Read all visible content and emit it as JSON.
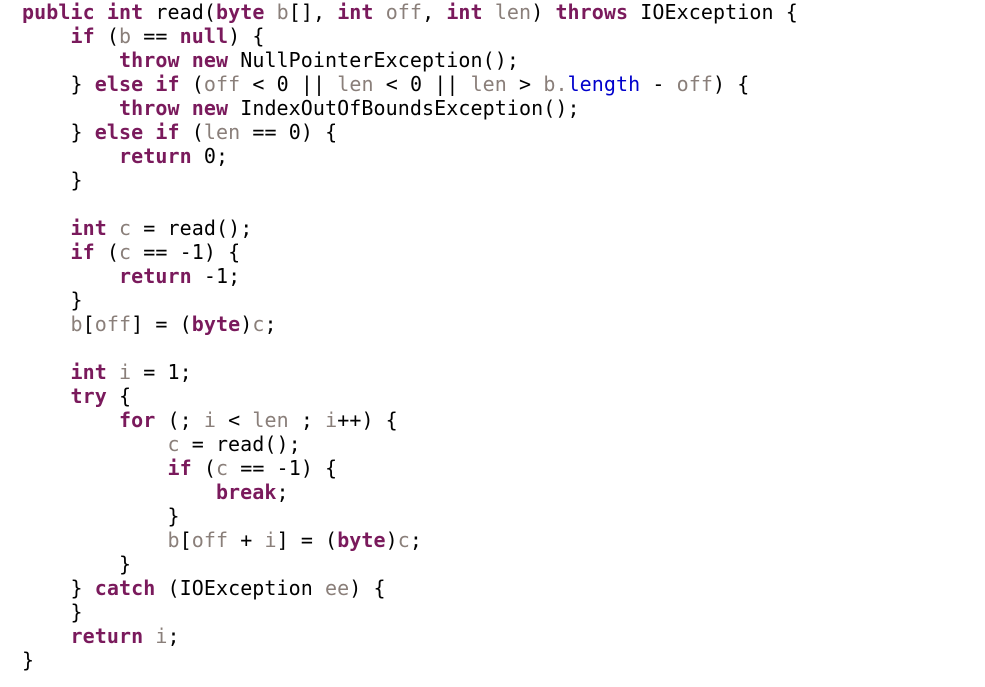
{
  "document": {
    "kind": "source-code-listing",
    "language": "Java",
    "background_color": "#ffffff",
    "font_size_px": 20,
    "line_height_px": 24,
    "indent_spaces": 4,
    "theme": {
      "keyword_color": "#7a1a5c",
      "identifier_color": "#8a7f7a",
      "field_color": "#0000cc",
      "plain_color": "#000000"
    }
  },
  "code": {
    "plain_text": "public int read(byte b[], int off, int len) throws IOException {\n    if (b == null) {\n        throw new NullPointerException();\n    } else if (off < 0 || len < 0 || len > b.length - off) {\n        throw new IndexOutOfBoundsException();\n    } else if (len == 0) {\n        return 0;\n    }\n\n    int c = read();\n    if (c == -1) {\n        return -1;\n    }\n    b[off] = (byte)c;\n\n    int i = 1;\n    try {\n        for (; i < len ; i++) {\n            c = read();\n            if (c == -1) {\n                break;\n            }\n            b[off + i] = (byte)c;\n        }\n    } catch (IOException ee) {\n    }\n    return i;\n}",
    "lines": [
      {
        "n": 1,
        "indent": 0,
        "tokens": [
          {
            "t": "public",
            "c": "kw"
          },
          {
            "t": " ",
            "c": "plain"
          },
          {
            "t": "int",
            "c": "kw"
          },
          {
            "t": " read(",
            "c": "plain"
          },
          {
            "t": "byte",
            "c": "kw"
          },
          {
            "t": " ",
            "c": "plain"
          },
          {
            "t": "b",
            "c": "var"
          },
          {
            "t": "[], ",
            "c": "plain"
          },
          {
            "t": "int",
            "c": "kw"
          },
          {
            "t": " ",
            "c": "plain"
          },
          {
            "t": "off",
            "c": "var"
          },
          {
            "t": ", ",
            "c": "plain"
          },
          {
            "t": "int",
            "c": "kw"
          },
          {
            "t": " ",
            "c": "plain"
          },
          {
            "t": "len",
            "c": "var"
          },
          {
            "t": ") ",
            "c": "plain"
          },
          {
            "t": "throws",
            "c": "kw"
          },
          {
            "t": " IOException {",
            "c": "plain"
          }
        ]
      },
      {
        "n": 2,
        "indent": 1,
        "tokens": [
          {
            "t": "if",
            "c": "kw"
          },
          {
            "t": " (",
            "c": "plain"
          },
          {
            "t": "b",
            "c": "var"
          },
          {
            "t": " == ",
            "c": "plain"
          },
          {
            "t": "null",
            "c": "kw"
          },
          {
            "t": ") {",
            "c": "plain"
          }
        ]
      },
      {
        "n": 3,
        "indent": 2,
        "tokens": [
          {
            "t": "throw",
            "c": "kw"
          },
          {
            "t": " ",
            "c": "plain"
          },
          {
            "t": "new",
            "c": "kw"
          },
          {
            "t": " NullPointerException();",
            "c": "plain"
          }
        ]
      },
      {
        "n": 4,
        "indent": 1,
        "tokens": [
          {
            "t": "} ",
            "c": "plain"
          },
          {
            "t": "else",
            "c": "kw"
          },
          {
            "t": " ",
            "c": "plain"
          },
          {
            "t": "if",
            "c": "kw"
          },
          {
            "t": " (",
            "c": "plain"
          },
          {
            "t": "off",
            "c": "var"
          },
          {
            "t": " < ",
            "c": "plain"
          },
          {
            "t": "0",
            "c": "num"
          },
          {
            "t": " || ",
            "c": "plain"
          },
          {
            "t": "len",
            "c": "var"
          },
          {
            "t": " < ",
            "c": "plain"
          },
          {
            "t": "0",
            "c": "num"
          },
          {
            "t": " || ",
            "c": "plain"
          },
          {
            "t": "len",
            "c": "var"
          },
          {
            "t": " > ",
            "c": "plain"
          },
          {
            "t": "b",
            "c": "var"
          },
          {
            "t": ".",
            "c": "var"
          },
          {
            "t": "length",
            "c": "field"
          },
          {
            "t": " - ",
            "c": "plain"
          },
          {
            "t": "off",
            "c": "var"
          },
          {
            "t": ") {",
            "c": "plain"
          }
        ]
      },
      {
        "n": 5,
        "indent": 2,
        "tokens": [
          {
            "t": "throw",
            "c": "kw"
          },
          {
            "t": " ",
            "c": "plain"
          },
          {
            "t": "new",
            "c": "kw"
          },
          {
            "t": " IndexOutOfBoundsException();",
            "c": "plain"
          }
        ]
      },
      {
        "n": 6,
        "indent": 1,
        "tokens": [
          {
            "t": "} ",
            "c": "plain"
          },
          {
            "t": "else",
            "c": "kw"
          },
          {
            "t": " ",
            "c": "plain"
          },
          {
            "t": "if",
            "c": "kw"
          },
          {
            "t": " (",
            "c": "plain"
          },
          {
            "t": "len",
            "c": "var"
          },
          {
            "t": " == ",
            "c": "plain"
          },
          {
            "t": "0",
            "c": "num"
          },
          {
            "t": ") {",
            "c": "plain"
          }
        ]
      },
      {
        "n": 7,
        "indent": 2,
        "tokens": [
          {
            "t": "return",
            "c": "kw"
          },
          {
            "t": " ",
            "c": "plain"
          },
          {
            "t": "0",
            "c": "num"
          },
          {
            "t": ";",
            "c": "plain"
          }
        ]
      },
      {
        "n": 8,
        "indent": 1,
        "tokens": [
          {
            "t": "}",
            "c": "plain"
          }
        ]
      },
      {
        "n": 9,
        "indent": 0,
        "blank": true,
        "tokens": []
      },
      {
        "n": 10,
        "indent": 1,
        "tokens": [
          {
            "t": "int",
            "c": "kw"
          },
          {
            "t": " ",
            "c": "plain"
          },
          {
            "t": "c",
            "c": "var"
          },
          {
            "t": " = read();",
            "c": "plain"
          }
        ]
      },
      {
        "n": 11,
        "indent": 1,
        "tokens": [
          {
            "t": "if",
            "c": "kw"
          },
          {
            "t": " (",
            "c": "plain"
          },
          {
            "t": "c",
            "c": "var"
          },
          {
            "t": " == -",
            "c": "plain"
          },
          {
            "t": "1",
            "c": "num"
          },
          {
            "t": ") {",
            "c": "plain"
          }
        ]
      },
      {
        "n": 12,
        "indent": 2,
        "tokens": [
          {
            "t": "return",
            "c": "kw"
          },
          {
            "t": " -",
            "c": "plain"
          },
          {
            "t": "1",
            "c": "num"
          },
          {
            "t": ";",
            "c": "plain"
          }
        ]
      },
      {
        "n": 13,
        "indent": 1,
        "tokens": [
          {
            "t": "}",
            "c": "plain"
          }
        ]
      },
      {
        "n": 14,
        "indent": 1,
        "tokens": [
          {
            "t": "b",
            "c": "var"
          },
          {
            "t": "[",
            "c": "plain"
          },
          {
            "t": "off",
            "c": "var"
          },
          {
            "t": "] = (",
            "c": "plain"
          },
          {
            "t": "byte",
            "c": "kw"
          },
          {
            "t": ")",
            "c": "plain"
          },
          {
            "t": "c",
            "c": "var"
          },
          {
            "t": ";",
            "c": "plain"
          }
        ]
      },
      {
        "n": 15,
        "indent": 0,
        "blank": true,
        "tokens": []
      },
      {
        "n": 16,
        "indent": 1,
        "tokens": [
          {
            "t": "int",
            "c": "kw"
          },
          {
            "t": " ",
            "c": "plain"
          },
          {
            "t": "i",
            "c": "var"
          },
          {
            "t": " = ",
            "c": "plain"
          },
          {
            "t": "1",
            "c": "num"
          },
          {
            "t": ";",
            "c": "plain"
          }
        ]
      },
      {
        "n": 17,
        "indent": 1,
        "tokens": [
          {
            "t": "try",
            "c": "kw"
          },
          {
            "t": " {",
            "c": "plain"
          }
        ]
      },
      {
        "n": 18,
        "indent": 2,
        "tokens": [
          {
            "t": "for",
            "c": "kw"
          },
          {
            "t": " (; ",
            "c": "plain"
          },
          {
            "t": "i",
            "c": "var"
          },
          {
            "t": " < ",
            "c": "plain"
          },
          {
            "t": "len",
            "c": "var"
          },
          {
            "t": " ; ",
            "c": "plain"
          },
          {
            "t": "i",
            "c": "var"
          },
          {
            "t": "++) {",
            "c": "plain"
          }
        ]
      },
      {
        "n": 19,
        "indent": 3,
        "tokens": [
          {
            "t": "c",
            "c": "var"
          },
          {
            "t": " = read();",
            "c": "plain"
          }
        ]
      },
      {
        "n": 20,
        "indent": 3,
        "tokens": [
          {
            "t": "if",
            "c": "kw"
          },
          {
            "t": " (",
            "c": "plain"
          },
          {
            "t": "c",
            "c": "var"
          },
          {
            "t": " == -",
            "c": "plain"
          },
          {
            "t": "1",
            "c": "num"
          },
          {
            "t": ") {",
            "c": "plain"
          }
        ]
      },
      {
        "n": 21,
        "indent": 4,
        "tokens": [
          {
            "t": "break",
            "c": "kw"
          },
          {
            "t": ";",
            "c": "plain"
          }
        ]
      },
      {
        "n": 22,
        "indent": 3,
        "tokens": [
          {
            "t": "}",
            "c": "plain"
          }
        ]
      },
      {
        "n": 23,
        "indent": 3,
        "tokens": [
          {
            "t": "b",
            "c": "var"
          },
          {
            "t": "[",
            "c": "plain"
          },
          {
            "t": "off",
            "c": "var"
          },
          {
            "t": " + ",
            "c": "plain"
          },
          {
            "t": "i",
            "c": "var"
          },
          {
            "t": "] = (",
            "c": "plain"
          },
          {
            "t": "byte",
            "c": "kw"
          },
          {
            "t": ")",
            "c": "plain"
          },
          {
            "t": "c",
            "c": "var"
          },
          {
            "t": ";",
            "c": "plain"
          }
        ]
      },
      {
        "n": 24,
        "indent": 2,
        "tokens": [
          {
            "t": "}",
            "c": "plain"
          }
        ]
      },
      {
        "n": 25,
        "indent": 1,
        "tokens": [
          {
            "t": "} ",
            "c": "plain"
          },
          {
            "t": "catch",
            "c": "kw"
          },
          {
            "t": " (IOException ",
            "c": "plain"
          },
          {
            "t": "ee",
            "c": "var"
          },
          {
            "t": ") {",
            "c": "plain"
          }
        ]
      },
      {
        "n": 26,
        "indent": 1,
        "tokens": [
          {
            "t": "}",
            "c": "plain"
          }
        ]
      },
      {
        "n": 27,
        "indent": 1,
        "tokens": [
          {
            "t": "return",
            "c": "kw"
          },
          {
            "t": " ",
            "c": "plain"
          },
          {
            "t": "i",
            "c": "var"
          },
          {
            "t": ";",
            "c": "plain"
          }
        ]
      },
      {
        "n": 28,
        "indent": 0,
        "tokens": [
          {
            "t": "}",
            "c": "plain"
          }
        ]
      }
    ]
  }
}
